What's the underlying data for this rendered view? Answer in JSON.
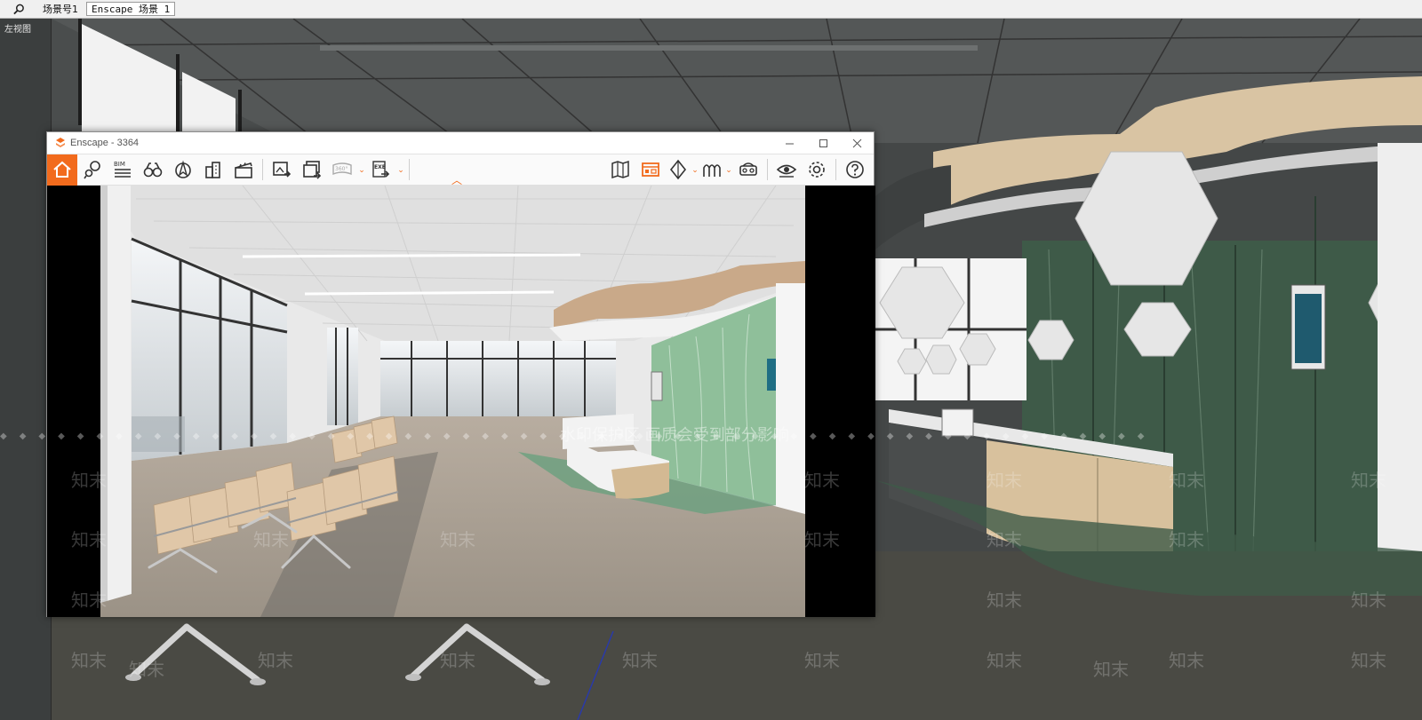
{
  "scene_bar": {
    "tabs": [
      {
        "label": "场景号1",
        "active": false
      },
      {
        "label": "Enscape 场景 1",
        "active": true
      }
    ]
  },
  "viewport": {
    "view_label": "左视图"
  },
  "enscape": {
    "title": "Enscape - 3364",
    "toolbar": {
      "bim_label": "BIM",
      "pano_label": "360°",
      "exe_label": "EXE"
    },
    "icons": [
      "home-icon",
      "location-pin-icon",
      "bim-list-icon",
      "binoculars-icon",
      "compass-icon",
      "buildings-icon",
      "clapper-icon",
      "export-image-icon",
      "batch-render-icon",
      "panorama-icon",
      "exe-export-icon",
      "map-icon",
      "asset-library-icon",
      "material-icon",
      "sky-icon",
      "vr-headset-icon",
      "eye-icon",
      "gear-icon",
      "help-icon"
    ]
  },
  "watermark": {
    "brand": "知末",
    "banner": "水印保护区  画质会受到部分影响",
    "diamonds": "◆◆◆◆◆◆◆◆◆◆◆◆◆◆◆◆◆◆◆◆◆◆◆◆◆◆◆◆◆◆◆◆◆◆◆◆◆◆◆◆◆◆◆◆◆◆◆◆◆◆◆◆◆◆◆◆◆◆◆◆"
  },
  "colors": {
    "accent": "#f26b1d",
    "wall_green": "#3e5a48",
    "wood": "#d9c4a3"
  }
}
